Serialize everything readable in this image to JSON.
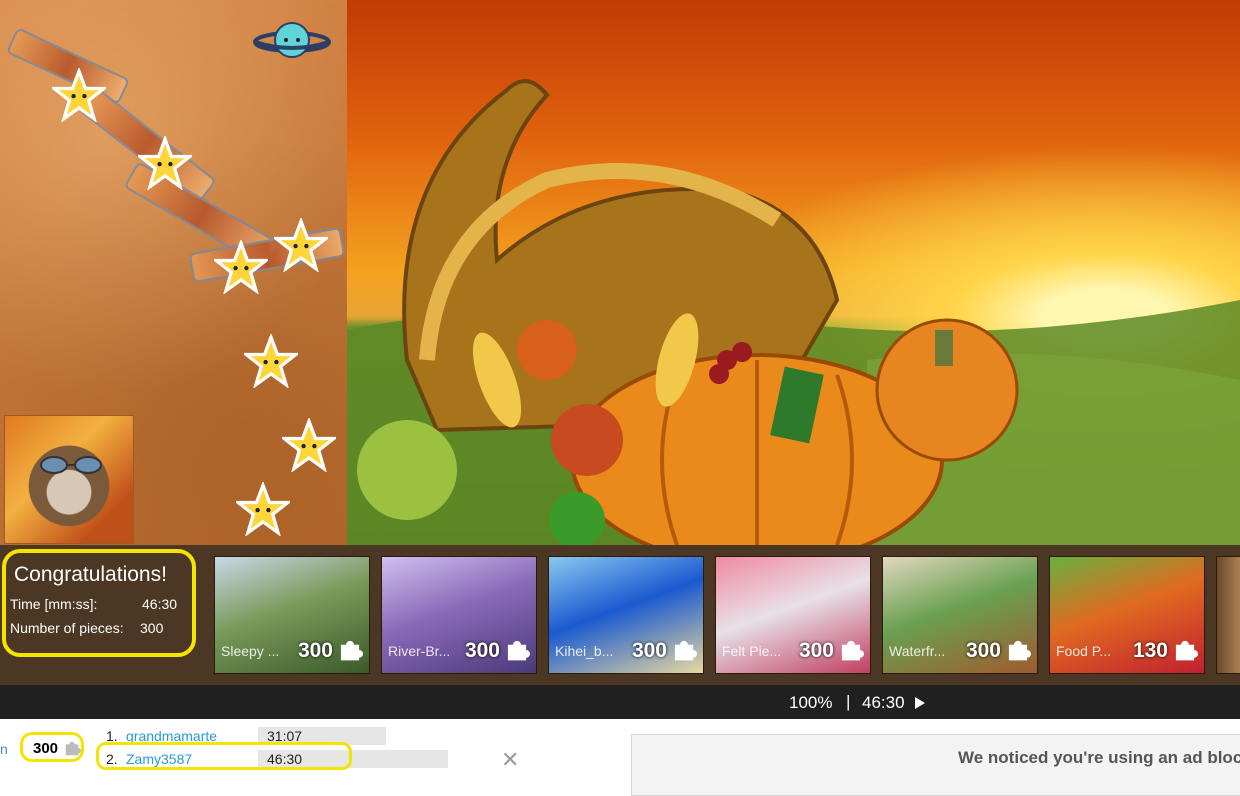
{
  "congratulations": {
    "title": "Congratulations!",
    "time_label": "Time [mm:ss]:",
    "time_value": "46:30",
    "pieces_label": "Number of pieces:",
    "pieces_value": "300"
  },
  "thumbnails": [
    {
      "name": "Sleepy ...",
      "count": "300",
      "colors": [
        "#7a9a5a",
        "#c8d8e8",
        "#3a5a2a"
      ]
    },
    {
      "name": "River-Br...",
      "count": "300",
      "colors": [
        "#8a6ab8",
        "#d0c0f0",
        "#4a3a7a"
      ]
    },
    {
      "name": "Kihei_b...",
      "count": "300",
      "colors": [
        "#1a5ad0",
        "#8ac8f0",
        "#e8d8a0"
      ]
    },
    {
      "name": "Felt Pie...",
      "count": "300",
      "colors": [
        "#e8e0e8",
        "#f08aa0",
        "#c04060"
      ]
    },
    {
      "name": "Waterfr...",
      "count": "300",
      "colors": [
        "#6aa050",
        "#e0d8c0",
        "#a05a30"
      ]
    },
    {
      "name": "Food P...",
      "count": "130",
      "colors": [
        "#e06a20",
        "#6ab040",
        "#c02030"
      ]
    }
  ],
  "status_bar": {
    "zoom": "100%",
    "separator": "|",
    "timer": "46:30"
  },
  "leaderboard": {
    "left_letter": "n",
    "pieces": "300",
    "rows": [
      {
        "rank": "1.",
        "name": "grandmamarte",
        "time": "31:07"
      },
      {
        "rank": "2.",
        "name": "Zamy3587",
        "time": "46:30"
      }
    ],
    "close": "✕"
  },
  "adblock": {
    "message": "We noticed you're using an ad bloc"
  },
  "colors": {
    "highlight": "#f5e400",
    "link": "#2a9bd4",
    "strip_bg": "#3c2610",
    "status_bg": "#202020"
  },
  "icons": {
    "piece": "puzzle-piece-icon",
    "play": "play-icon",
    "planet": "planet-icon",
    "star": "star-icon"
  }
}
